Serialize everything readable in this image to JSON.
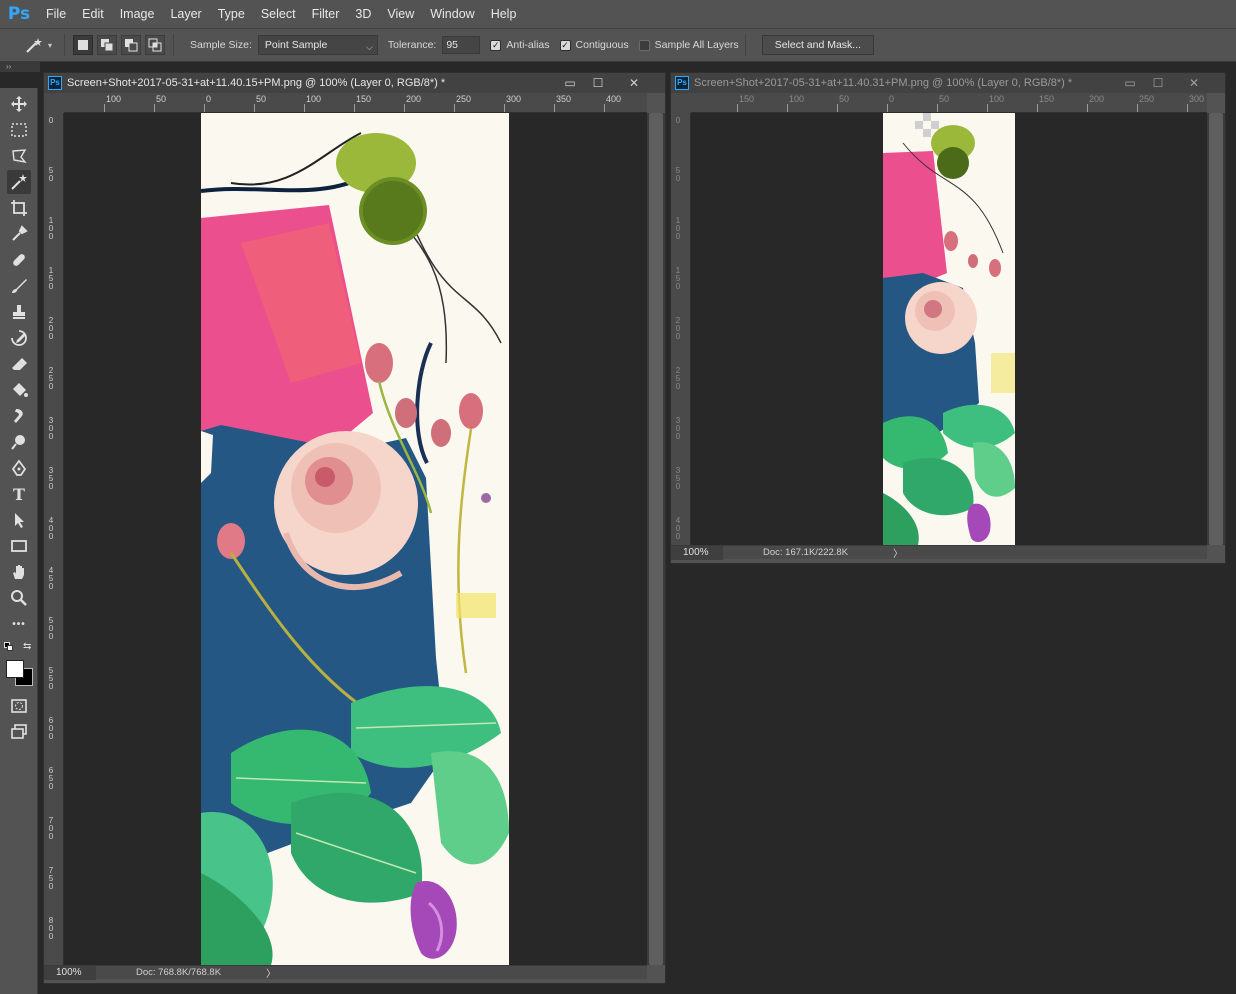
{
  "app": {
    "logo": "Ps"
  },
  "menu": [
    "File",
    "Edit",
    "Image",
    "Layer",
    "Type",
    "Select",
    "Filter",
    "3D",
    "View",
    "Window",
    "Help"
  ],
  "options": {
    "sample_size_label": "Sample Size:",
    "sample_size_value": "Point Sample",
    "tolerance_label": "Tolerance:",
    "tolerance_value": "95",
    "anti_alias_label": "Anti-alias",
    "anti_alias_checked": true,
    "contiguous_label": "Contiguous",
    "contiguous_checked": true,
    "sample_all_layers_label": "Sample All Layers",
    "sample_all_layers_checked": false,
    "select_and_mask_label": "Select and Mask..."
  },
  "toolbar": {
    "tools": [
      "move-tool-icon",
      "marquee-tool-icon",
      "lasso-tool-icon",
      "magic-wand-tool-icon",
      "crop-tool-icon",
      "eyedropper-tool-icon",
      "healing-brush-tool-icon",
      "brush-tool-icon",
      "clone-stamp-tool-icon",
      "history-brush-tool-icon",
      "eraser-tool-icon",
      "paint-bucket-tool-icon",
      "smudge-tool-icon",
      "dodge-tool-icon",
      "pen-tool-icon",
      "type-tool-icon",
      "path-selection-tool-icon",
      "rectangle-tool-icon",
      "hand-tool-icon",
      "zoom-tool-icon",
      "more-tools-icon"
    ],
    "active_tool": "magic-wand-tool-icon",
    "type_glyph": "T",
    "more_glyph": "•••"
  },
  "documents": [
    {
      "title": "Screen+Shot+2017-05-31+at+11.40.15+PM.png @ 100% (Layer 0, RGB/8*) *",
      "ruler_h_labels": [
        "100",
        "50",
        "0",
        "50",
        "100",
        "150",
        "200",
        "250",
        "300",
        "350",
        "400"
      ],
      "ruler_v_labels": [
        "0",
        "50",
        "100",
        "150",
        "200",
        "250",
        "300",
        "350",
        "400",
        "450",
        "500",
        "550",
        "600",
        "650",
        "700",
        "750",
        "800"
      ],
      "zoom": "100%",
      "doc_info": "Doc: 768.8K/768.8K",
      "status_arrow": "〉",
      "active": true
    },
    {
      "title": "Screen+Shot+2017-05-31+at+11.40.31+PM.png @ 100% (Layer 0, RGB/8*) *",
      "ruler_h_labels": [
        "150",
        "100",
        "50",
        "0",
        "50",
        "100",
        "150",
        "200",
        "250",
        "300"
      ],
      "ruler_v_labels": [
        "0",
        "50",
        "100",
        "150",
        "200",
        "250",
        "300",
        "350",
        "400"
      ],
      "zoom": "100%",
      "doc_info": "Doc: 167.1K/222.8K",
      "status_arrow": "〉",
      "active": false
    }
  ],
  "window_controls": {
    "minimize": "▭",
    "maximize": "☐",
    "close": "✕"
  },
  "colors": {
    "accent": "#31a8ff",
    "panel": "#535353",
    "workspace": "#282828"
  }
}
